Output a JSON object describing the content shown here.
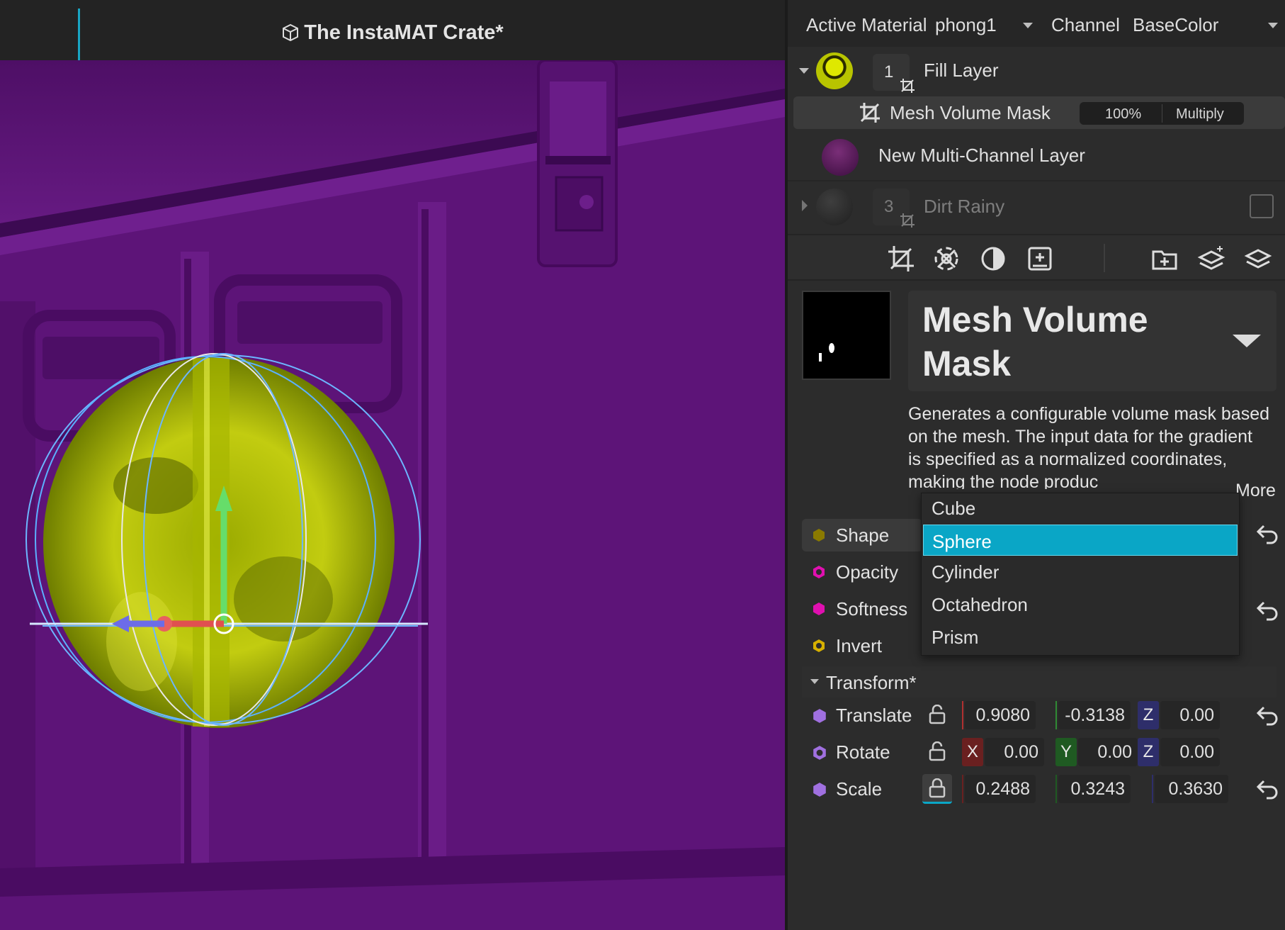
{
  "viewport": {
    "title": "The InstaMAT Crate*"
  },
  "header": {
    "active_material_label": "Active Material",
    "active_material_value": "phong1",
    "channel_label": "Channel",
    "channel_value": "BaseColor"
  },
  "layers": {
    "fill_layer": {
      "number": "1",
      "name": "Fill Layer"
    },
    "mask": {
      "name": "Mesh Volume Mask",
      "opacity": "100%",
      "blend": "Multiply"
    },
    "multi_channel": {
      "name": "New Multi-Channel Layer"
    },
    "dirt": {
      "number": "3",
      "name": "Dirt Rainy"
    }
  },
  "inspector": {
    "title": "Mesh Volume Mask",
    "description": "Generates a configurable volume mask based on the mesh. The input data for the gradient is specified as a normalized coordinates, making the node produc",
    "more_label": "More"
  },
  "properties": {
    "shape_label": "Shape",
    "opacity_label": "Opacity",
    "softness_label": "Softness",
    "invert_label": "Invert"
  },
  "shape_menu": {
    "options": [
      "Cube",
      "Sphere",
      "Cylinder",
      "Octahedron",
      "Prism"
    ],
    "selected": "Sphere"
  },
  "transform": {
    "label": "Transform*",
    "translate": {
      "label": "Translate",
      "x": "0.9080",
      "y": "-0.3138",
      "z": "0.00"
    },
    "rotate": {
      "label": "Rotate",
      "x": "0.00",
      "y": "0.00",
      "z": "0.00"
    },
    "scale": {
      "label": "Scale",
      "x": "0.2488",
      "y": "0.3243",
      "z": "0.3630"
    },
    "axis_labels": {
      "x": "X",
      "y": "Y",
      "z": "Z"
    }
  },
  "colors": {
    "accent": "#0aa6c6",
    "viewport_bg": "#5d1478",
    "mask_yellow": "#c8d400"
  }
}
